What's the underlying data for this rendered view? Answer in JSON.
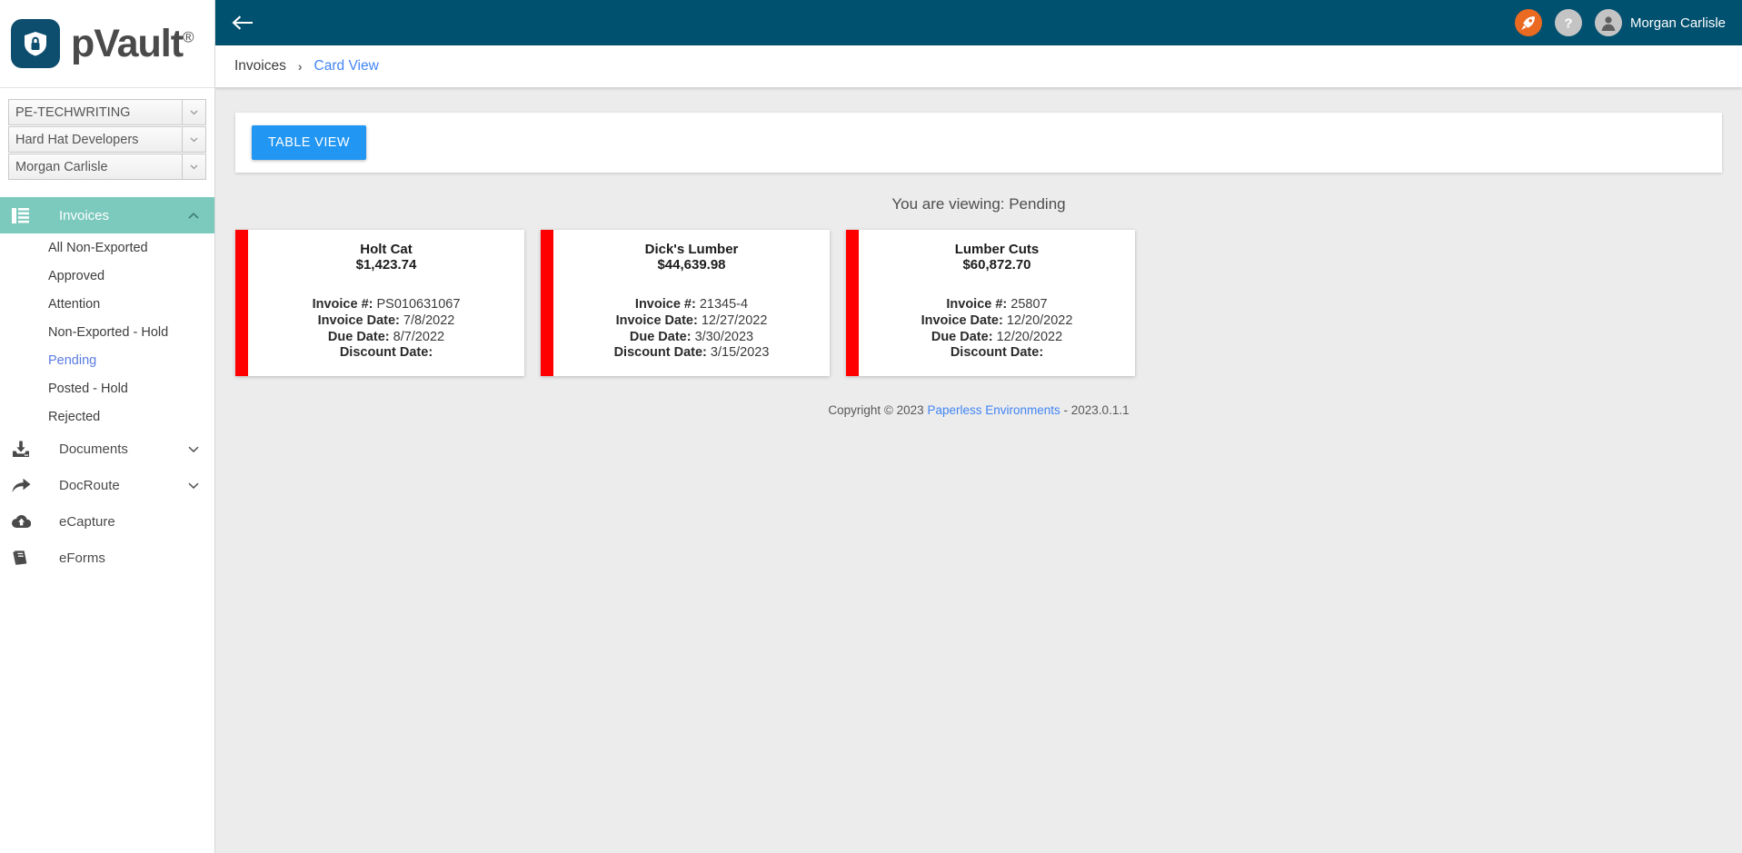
{
  "app": {
    "logo_text": "pVault",
    "logo_reg": "®",
    "logo_icon": "shield-lock-icon",
    "brand_navy": "#00506f",
    "accent_teal": "#7cc9be",
    "accent_blue": "#2196f3",
    "card_accent_red": "#ff0000"
  },
  "sidebar": {
    "selectors": [
      {
        "label": "PE-TECHWRITING",
        "arrow": "chevron-down-icon"
      },
      {
        "label": "Hard Hat Developers",
        "arrow": "chevron-down-icon"
      },
      {
        "label": "Morgan Carlisle",
        "arrow": "chevron-down-icon"
      }
    ],
    "groups": [
      {
        "label": "Invoices",
        "icon": "list-icon",
        "active": true,
        "expanded": true,
        "chevron": "chevron-up-icon",
        "items": [
          {
            "label": "All Non-Exported",
            "selected": false
          },
          {
            "label": "Approved",
            "selected": false
          },
          {
            "label": "Attention",
            "selected": false
          },
          {
            "label": "Non-Exported - Hold",
            "selected": false
          },
          {
            "label": "Pending",
            "selected": true
          },
          {
            "label": "Posted - Hold",
            "selected": false
          },
          {
            "label": "Rejected",
            "selected": false
          }
        ]
      },
      {
        "label": "Documents",
        "icon": "download-inbox-icon",
        "active": false,
        "expanded": false,
        "chevron": "chevron-down-icon",
        "items": []
      },
      {
        "label": "DocRoute",
        "icon": "share-arrow-icon",
        "active": false,
        "expanded": false,
        "chevron": "chevron-down-icon",
        "items": []
      },
      {
        "label": "eCapture",
        "icon": "cloud-upload-icon",
        "active": false,
        "expanded": false,
        "chevron": "",
        "items": []
      },
      {
        "label": "eForms",
        "icon": "book-icon",
        "active": false,
        "expanded": false,
        "chevron": "",
        "items": []
      }
    ]
  },
  "topbar": {
    "back_icon": "back-arrow-icon",
    "rocket_icon": "rocket-icon",
    "help_icon": "question-mark-icon",
    "avatar_icon": "user-avatar-icon",
    "user_name": "Morgan Carlisle"
  },
  "breadcrumb": {
    "root": "Invoices",
    "separator": "›",
    "current": "Card View"
  },
  "toolbar": {
    "table_view_label": "TABLE VIEW"
  },
  "main": {
    "viewing_text": "You are viewing: Pending",
    "cards": [
      {
        "vendor": "Holt Cat",
        "amount": "$1,423.74",
        "invoice_number_label": "Invoice #:",
        "invoice_number": "PS010631067",
        "invoice_date_label": "Invoice Date:",
        "invoice_date": "7/8/2022",
        "due_date_label": "Due Date:",
        "due_date": "8/7/2022",
        "discount_date_label": "Discount Date:",
        "discount_date": ""
      },
      {
        "vendor": "Dick's Lumber",
        "amount": "$44,639.98",
        "invoice_number_label": "Invoice #:",
        "invoice_number": "21345-4",
        "invoice_date_label": "Invoice Date:",
        "invoice_date": "12/27/2022",
        "due_date_label": "Due Date:",
        "due_date": "3/30/2023",
        "discount_date_label": "Discount Date:",
        "discount_date": "3/15/2023"
      },
      {
        "vendor": "Lumber Cuts",
        "amount": "$60,872.70",
        "invoice_number_label": "Invoice #:",
        "invoice_number": "25807",
        "invoice_date_label": "Invoice Date:",
        "invoice_date": "12/20/2022",
        "due_date_label": "Due Date:",
        "due_date": "12/20/2022",
        "discount_date_label": "Discount Date:",
        "discount_date": ""
      }
    ]
  },
  "footer": {
    "copyright": "Copyright © 2023",
    "company": "Paperless Environments",
    "version": "- 2023.0.1.1"
  }
}
